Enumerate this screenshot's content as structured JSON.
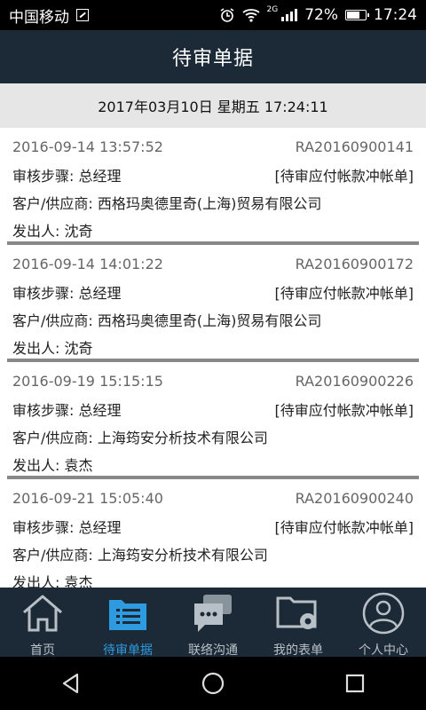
{
  "status_bar": {
    "carrier": "中国移动",
    "network": "2G",
    "battery": "72%",
    "battery_level": 0.72,
    "time": "17:24"
  },
  "header": {
    "title": "待审单据"
  },
  "date_bar": {
    "text": "2017年03月10日 星期五 17:24:11"
  },
  "records": [
    {
      "datetime": "2016-09-14 13:57:52",
      "code": "RA20160900141",
      "step": "审核步骤: 总经理",
      "type": "[待审应付帐款冲帐单]",
      "party": "客户/供应商: 西格玛奥德里奇(上海)贸易有限公司",
      "sender": "发出人: 沈奇"
    },
    {
      "datetime": "2016-09-14 14:01:22",
      "code": "RA20160900172",
      "step": "审核步骤: 总经理",
      "type": "[待审应付帐款冲帐单]",
      "party": "客户/供应商: 西格玛奥德里奇(上海)贸易有限公司",
      "sender": "发出人: 沈奇"
    },
    {
      "datetime": "2016-09-19 15:15:15",
      "code": "RA20160900226",
      "step": "审核步骤: 总经理",
      "type": "[待审应付帐款冲帐单]",
      "party": "客户/供应商: 上海筠安分析技术有限公司",
      "sender": "发出人: 袁杰"
    },
    {
      "datetime": "2016-09-21 15:05:40",
      "code": "RA20160900240",
      "step": "审核步骤: 总经理",
      "type": "[待审应付帐款冲帐单]",
      "party": "客户/供应商: 上海筠安分析技术有限公司",
      "sender": "发出人: 袁杰"
    }
  ],
  "tabs": [
    {
      "label": "首页",
      "icon": "home-icon",
      "active": false
    },
    {
      "label": "待审单据",
      "icon": "document-list-icon",
      "active": true
    },
    {
      "label": "联络沟通",
      "icon": "chat-icon",
      "active": false
    },
    {
      "label": "我的表单",
      "icon": "folder-settings-icon",
      "active": false
    },
    {
      "label": "个人中心",
      "icon": "user-icon",
      "active": false
    }
  ],
  "colors": {
    "accent": "#2e9be0",
    "header_bg": "#1b2a36",
    "inactive_tab": "#b8c0c7"
  }
}
